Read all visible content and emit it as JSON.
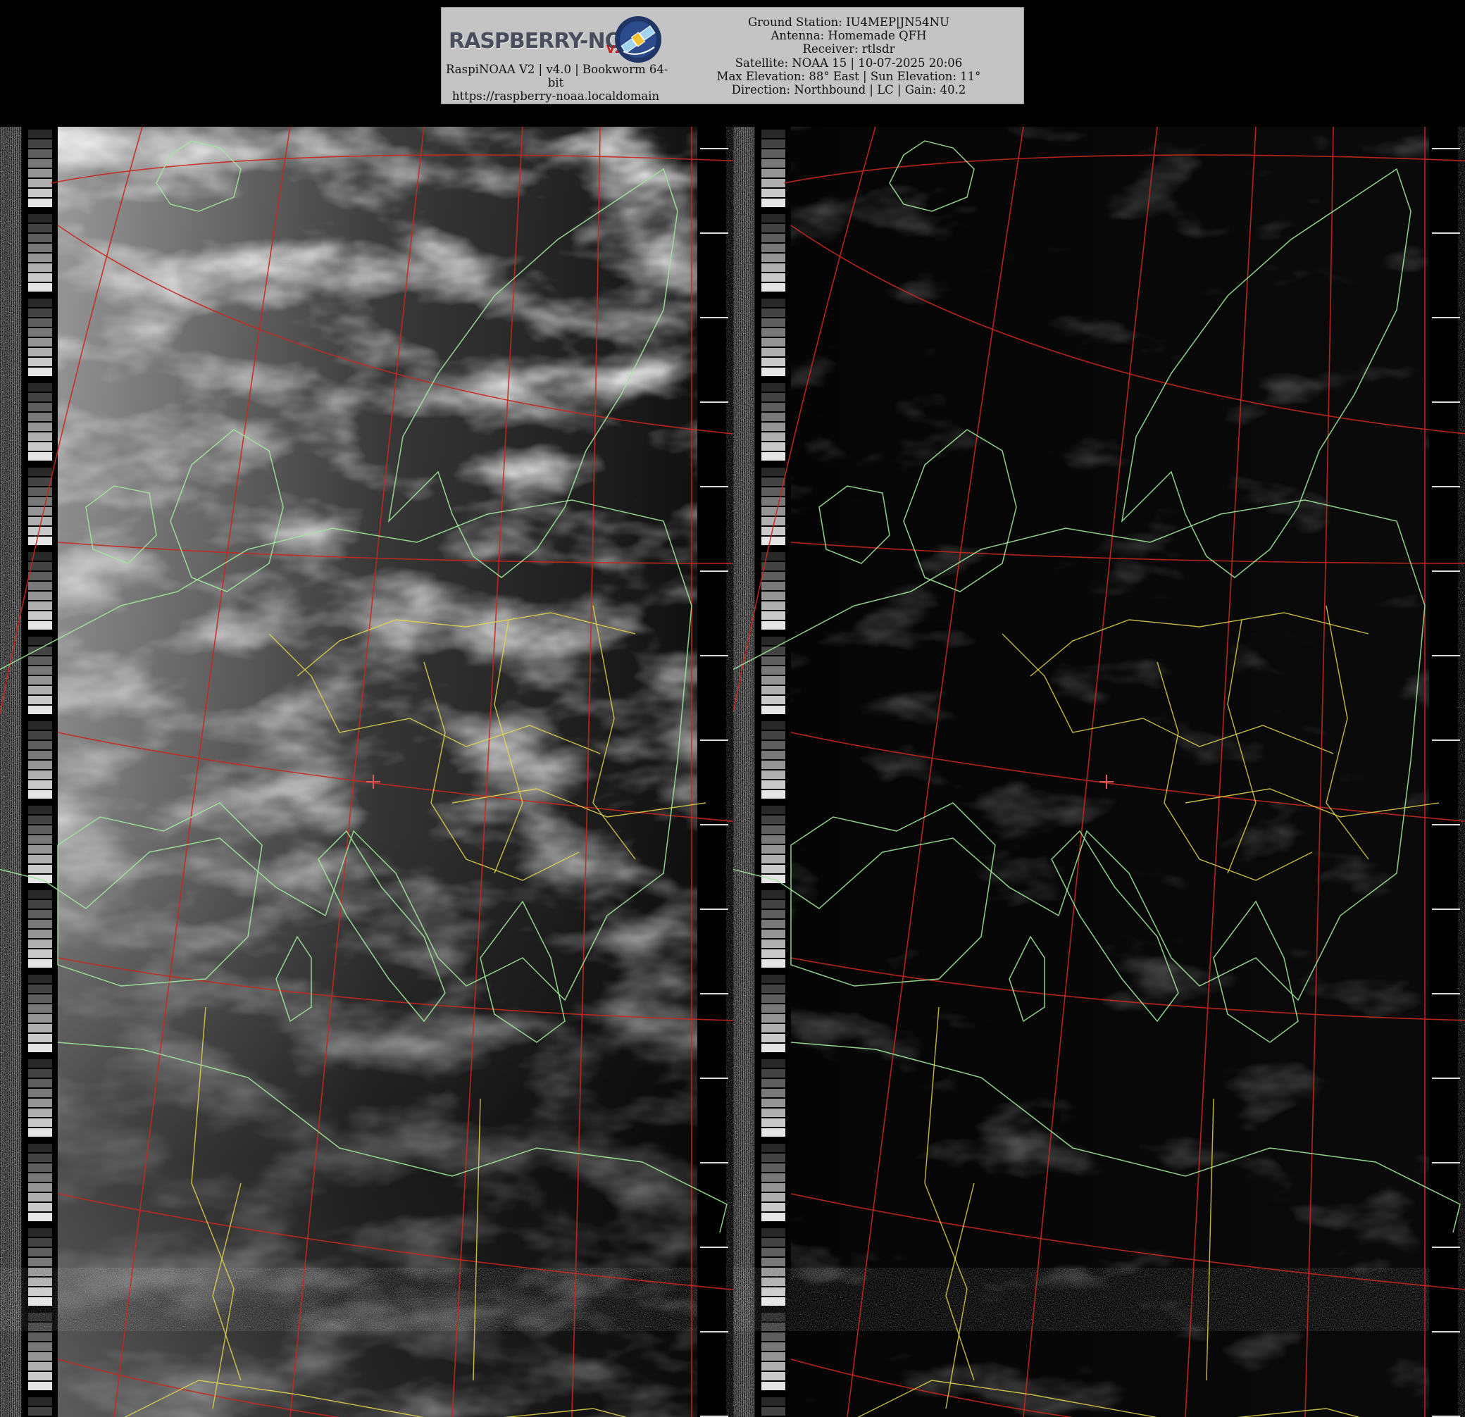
{
  "header": {
    "logo": {
      "wordmark": "RASPBERRY-NOAA",
      "version_badge": "V2",
      "emblem_icon": "satellite-icon"
    },
    "software_lines": [
      "RaspiNOAA V2 | v4.0 | Bookworm 64-",
      "bit",
      "https://raspberry-noaa.localdomain"
    ],
    "station_lines": [
      "Ground Station: IU4MEP|JN54NU",
      "Antenna: Homemade QFH",
      "Receiver: rtlsdr",
      "Satellite: NOAA 15 | 10-07-2025 20:06",
      "Max Elevation: 88° East | Sun Elevation: 11°",
      "Direction: Northbound | LC | Gain: 40.2"
    ]
  },
  "image": {
    "channels": [
      {
        "id": "channel-a",
        "description_icon": "visible-channel-image"
      },
      {
        "id": "channel-b",
        "description_icon": "infrared-channel-image"
      }
    ],
    "overlay_colors": {
      "graticule": "#c8281e",
      "coastline": "#9ee89a",
      "borders": "#e6d84a",
      "station_marker": "#e05a5a"
    }
  }
}
